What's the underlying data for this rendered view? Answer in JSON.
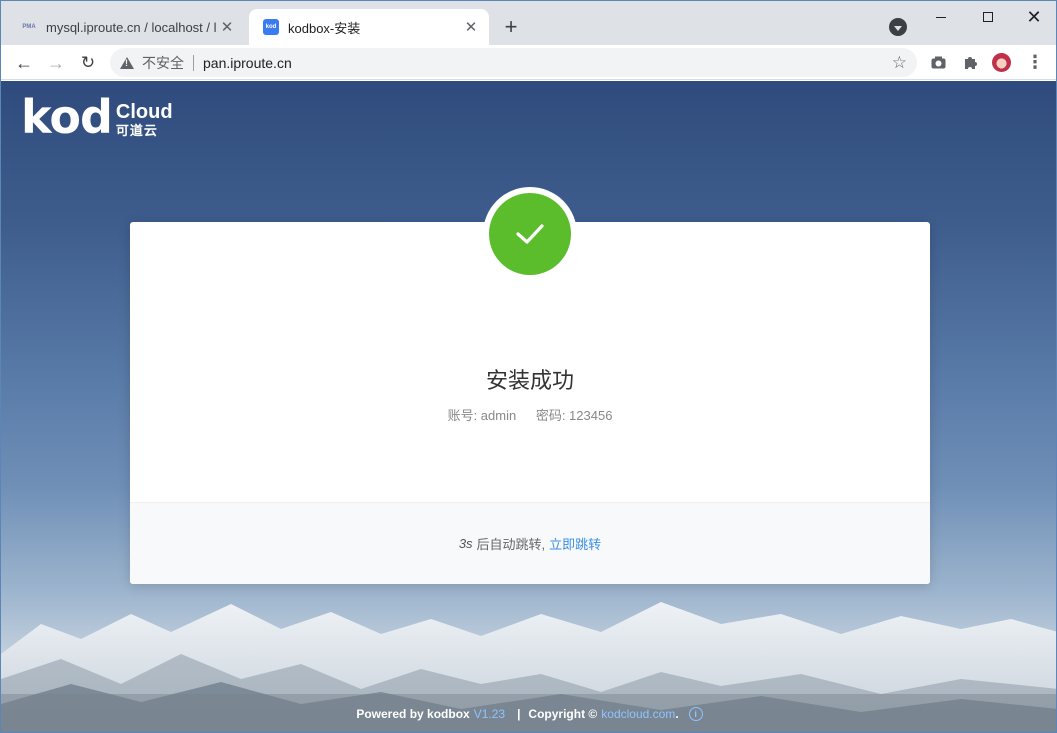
{
  "browser": {
    "tabs": [
      {
        "title": "mysql.iproute.cn / localhost / l",
        "favicon": "phpmyadmin-icon",
        "active": false
      },
      {
        "title": "kodbox-安装",
        "favicon": "kod-icon",
        "active": true
      }
    ],
    "omnibox": {
      "security_label": "不安全",
      "url": "pan.iproute.cn"
    }
  },
  "page": {
    "logo": {
      "brand": "kod",
      "cloud": "Cloud",
      "cn": "可道云"
    },
    "card": {
      "title": "安装成功",
      "account": "账号: admin",
      "password": "密码: 123456",
      "countdown": "3s",
      "redirect_text": "后自动跳转,",
      "jump_link": "立即跳转"
    },
    "footer": {
      "powered": "Powered by kodbox",
      "version": "V1.23",
      "copyright": "Copyright ©",
      "link": "kodcloud.com",
      "dot": "."
    }
  },
  "colors": {
    "success": "#5bbd2b",
    "link": "#3a8ee6",
    "accent_blue": "#8fc3ff"
  }
}
